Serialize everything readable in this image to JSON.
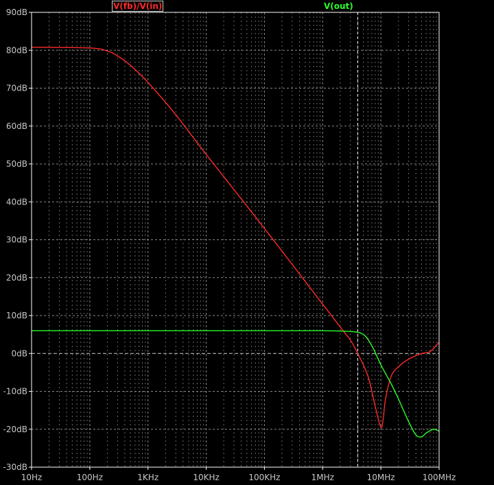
{
  "chart_data": {
    "type": "line",
    "x_scale": "log",
    "xlim": [
      10,
      100000000
    ],
    "ylim": [
      -30,
      90
    ],
    "grid": true,
    "x_ticks": [
      {
        "value": 10,
        "label": "10Hz"
      },
      {
        "value": 100,
        "label": "100Hz"
      },
      {
        "value": 1000,
        "label": "1KHz"
      },
      {
        "value": 10000,
        "label": "10KHz"
      },
      {
        "value": 100000,
        "label": "100KHz"
      },
      {
        "value": 1000000,
        "label": "1MHz"
      },
      {
        "value": 10000000,
        "label": "10MHz"
      },
      {
        "value": 100000000,
        "label": "100MHz"
      }
    ],
    "y_ticks": [
      {
        "value": 90,
        "label": "90dB"
      },
      {
        "value": 80,
        "label": "80dB"
      },
      {
        "value": 70,
        "label": "70dB"
      },
      {
        "value": 60,
        "label": "60dB"
      },
      {
        "value": 50,
        "label": "50dB"
      },
      {
        "value": 40,
        "label": "40dB"
      },
      {
        "value": 30,
        "label": "30dB"
      },
      {
        "value": 20,
        "label": "20dB"
      },
      {
        "value": 10,
        "label": "10dB"
      },
      {
        "value": 0,
        "label": "0dB"
      },
      {
        "value": -10,
        "label": "-10dB"
      },
      {
        "value": -20,
        "label": "-20dB"
      },
      {
        "value": -30,
        "label": "-30dB"
      }
    ],
    "cursor_x": 4000000,
    "series": [
      {
        "name": "V(fb)/V(in)",
        "color": "#ff2a2a",
        "x": [
          10,
          100,
          200,
          300,
          500,
          1000,
          3000,
          10000,
          100000,
          1000000,
          2000000,
          3000000,
          4000000,
          6000000,
          8000000,
          10000000,
          11000000,
          12000000,
          15000000,
          20000000,
          30000000,
          50000000,
          70000000,
          100000000
        ],
        "y": [
          80.8,
          80.6,
          79.8,
          78.5,
          76,
          71.5,
          63,
          52.5,
          33,
          13,
          7,
          3.5,
          0,
          -6,
          -14,
          -19.5,
          -17,
          -12,
          -6,
          -3.5,
          -1.5,
          0,
          0.5,
          3
        ]
      },
      {
        "name": "V(out)",
        "color": "#2aff2a",
        "x": [
          10,
          100000,
          1000000,
          3000000,
          5000000,
          7000000,
          10000000,
          15000000,
          20000000,
          30000000,
          40000000,
          50000000,
          60000000,
          80000000,
          100000000
        ],
        "y": [
          6,
          6,
          6,
          5.8,
          5,
          2,
          -3,
          -8,
          -12,
          -18,
          -21.5,
          -22,
          -21,
          -20,
          -20.5
        ]
      }
    ]
  }
}
